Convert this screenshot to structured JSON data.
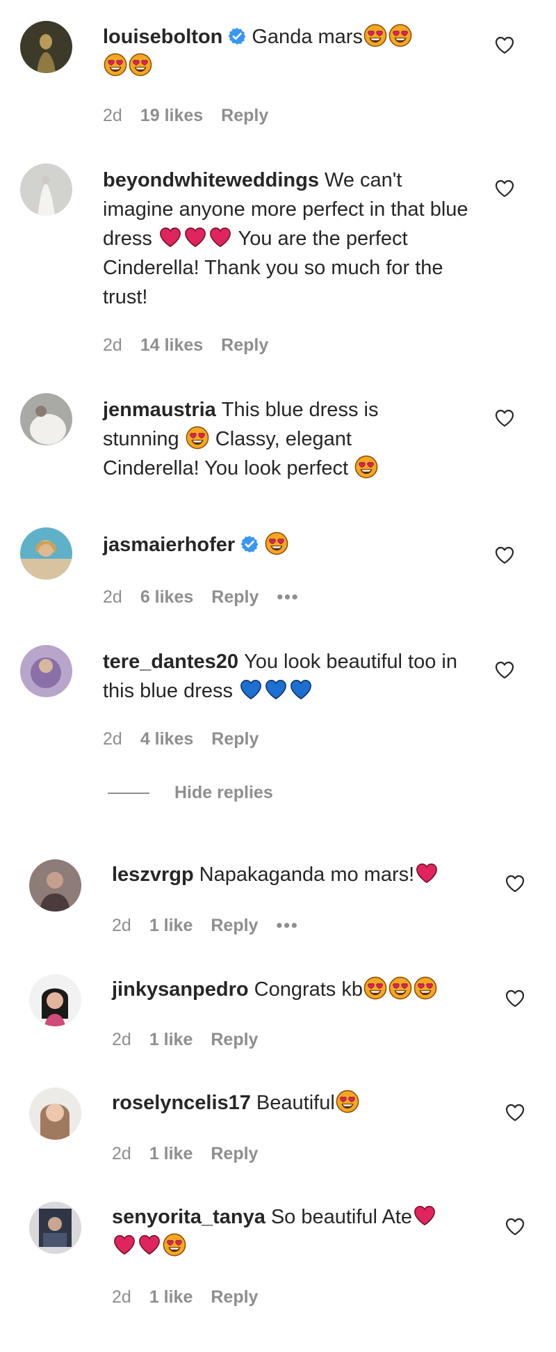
{
  "colors": {
    "text": "#262626",
    "meta": "#8e8e8e",
    "verified": "#3897f0",
    "red_heart": "#e0245e",
    "blue_heart": "#1d6fd1"
  },
  "icons": {
    "like": "heart-outline-icon",
    "verified": "verified-badge-icon",
    "more": "more-options-icon"
  },
  "comments": [
    {
      "username": "louisebolton",
      "verified": true,
      "text": "Ganda mars",
      "time": "2d",
      "likes": "19 likes",
      "reply": "Reply"
    },
    {
      "username": "beyondwhiteweddings",
      "verified": false,
      "text_a": "We can't imagine anyone more perfect in that blue dress",
      "text_b": "You are the perfect Cinderella! Thank you so much for the trust!",
      "time": "2d",
      "likes": "14 likes",
      "reply": "Reply"
    },
    {
      "username": "jenmaustria",
      "verified": false,
      "text_a": "This blue dress is stunning",
      "text_b": "Classy, elegant Cinderella! You look perfect"
    },
    {
      "username": "jasmaierhofer",
      "verified": true,
      "time": "2d",
      "likes": "6 likes",
      "reply": "Reply",
      "more": "•••"
    },
    {
      "username": "tere_dantes20",
      "verified": false,
      "text": "You look beautiful too in this blue dress",
      "time": "2d",
      "likes": "4 likes",
      "reply": "Reply"
    }
  ],
  "hide_replies": "Hide replies",
  "replies": [
    {
      "username": "leszvrgp",
      "text": "Napakaganda mo mars!",
      "time": "2d",
      "likes": "1 like",
      "reply": "Reply",
      "more": "•••"
    },
    {
      "username": "jinkysanpedro",
      "text": "Congrats kb",
      "time": "2d",
      "likes": "1 like",
      "reply": "Reply"
    },
    {
      "username": "roselyncelis17",
      "text": "Beautiful",
      "time": "2d",
      "likes": "1 like",
      "reply": "Reply"
    },
    {
      "username": "senyorita_tanya",
      "text": "So beautiful Ate",
      "time": "2d",
      "likes": "1 like",
      "reply": "Reply"
    }
  ]
}
